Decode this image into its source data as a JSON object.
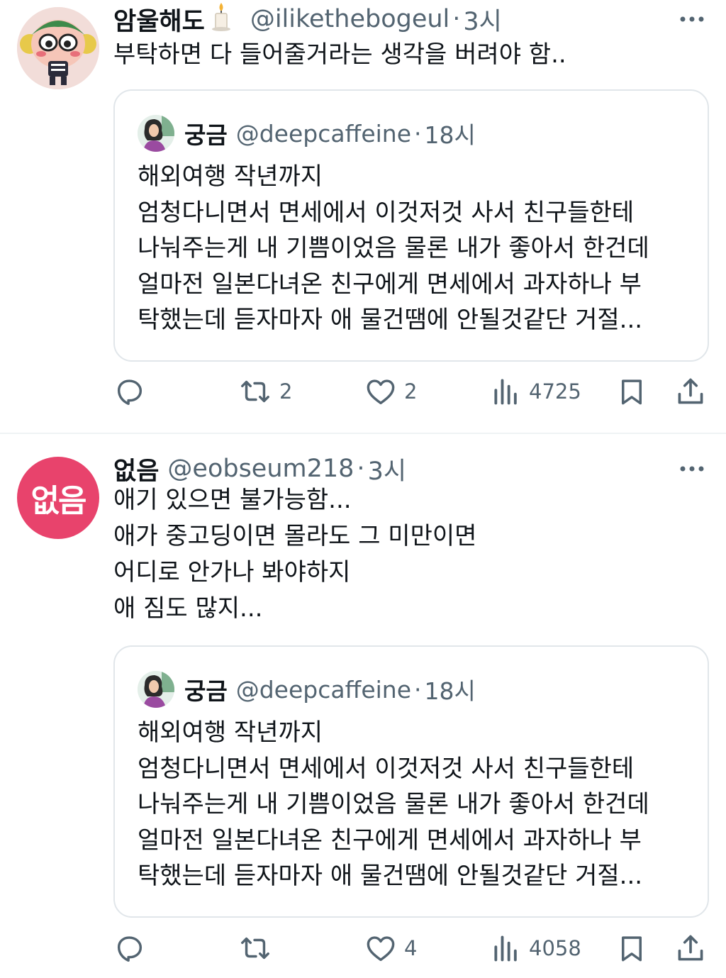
{
  "tweets": [
    {
      "name": "암울해도",
      "handle": "@ilikethebogeul",
      "dot": "·",
      "time": "3시",
      "text_lines": [
        "부탁하면 다 들어줄거라는 생각을 버려야 함.."
      ],
      "quote": {
        "name": "궁금",
        "handle": "@deepcaffeine",
        "dot": "·",
        "time": "18시",
        "lines": [
          "해외여행 작년까지",
          "엄청다니면서 면세에서 이것저것 사서 친구들한테",
          "나눠주는게 내 기쁨이었음 물론 내가 좋아서 한건데",
          "얼마전 일본다녀온 친구에게 면세에서 과자하나 부",
          "탁했는데 듣자마자 애 물건땜에 안될것같단 거절..."
        ]
      },
      "actions": {
        "reply": "",
        "retweet": "2",
        "like": "2",
        "views": "4725"
      }
    },
    {
      "name": "없음",
      "avatar_text": "없음",
      "handle": "@eobseum218",
      "dot": "·",
      "time": "3시",
      "text_lines": [
        "애기 있으면 불가능함...",
        "애가 중고딩이면 몰라도 그 미만이면",
        "어디로 안가나 봐야하지",
        "애 짐도 많지..."
      ],
      "quote": {
        "name": "궁금",
        "handle": "@deepcaffeine",
        "dot": "·",
        "time": "18시",
        "lines": [
          "해외여행 작년까지",
          "엄청다니면서 면세에서 이것저것 사서 친구들한테",
          "나눠주는게 내 기쁨이었음 물론 내가 좋아서 한건데",
          "얼마전 일본다녀온 친구에게 면세에서 과자하나 부",
          "탁했는데 듣자마자 애 물건땜에 안될것같단 거절..."
        ]
      },
      "actions": {
        "reply": "",
        "retweet": "",
        "like": "4",
        "views": "4058"
      }
    }
  ],
  "icons": {
    "reply": "speech-bubble-icon",
    "retweet": "retweet-arrows-icon",
    "like": "heart-outline-icon",
    "views": "bar-chart-icon",
    "bookmark": "bookmark-icon",
    "share": "share-upload-icon",
    "more": "horizontal-ellipsis-icon",
    "candle": "candle-emoji-icon"
  },
  "colors": {
    "text_primary": "#0f1419",
    "text_secondary": "#536471",
    "border": "#e1e6ea",
    "avatar_pink": "#e8436c"
  }
}
